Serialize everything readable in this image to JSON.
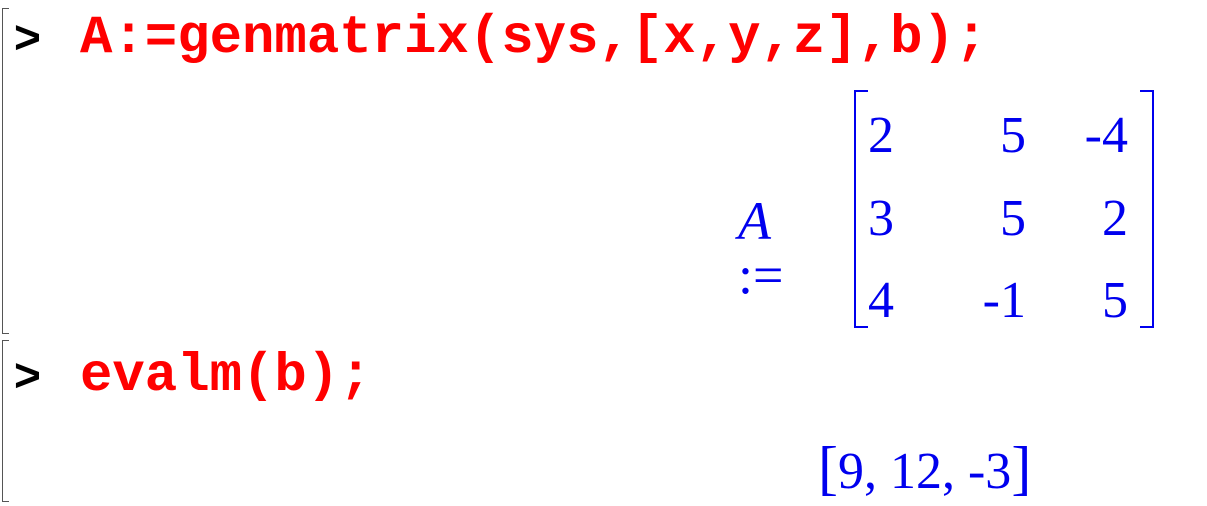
{
  "worksheet": {
    "groups": [
      {
        "prompt": ">",
        "input": "A:=genmatrix(sys,[x,y,z],b);",
        "output": {
          "variable": "A",
          "assign": ":=",
          "matrix": [
            [
              "2",
              "5",
              "-4"
            ],
            [
              "3",
              "5",
              "2"
            ],
            [
              "4",
              "-1",
              "5"
            ]
          ]
        }
      },
      {
        "prompt": ">",
        "input": "evalm(b);",
        "output": {
          "open_bracket": "[",
          "items": [
            "9",
            "12",
            "-3"
          ],
          "separator": ", ",
          "close_bracket": "]"
        }
      }
    ]
  },
  "colors": {
    "input": "#ff0000",
    "output": "#0000ee",
    "prompt": "#000000"
  }
}
